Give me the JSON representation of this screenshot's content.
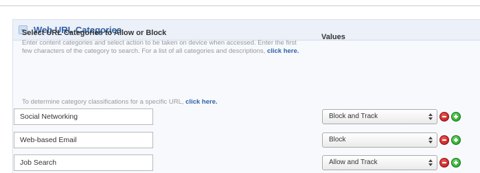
{
  "panel": {
    "title": "Web URL Categories"
  },
  "section": {
    "title": "Select URL Categories to Allow or Block",
    "values_header": "Values",
    "description": "Enter content categories and select action to be taken on device when accessed. Enter the first few characters of the category to search. For a list of all categories and descriptions,",
    "description_link": "click here.",
    "determine_text": "To determine category classifications for a specific URL,",
    "determine_link": "click here."
  },
  "rows": [
    {
      "category": "Social Networking",
      "action": "Block and Track"
    },
    {
      "category": "Web-based Email",
      "action": "Block"
    },
    {
      "category": "Job Search",
      "action": "Allow and Track"
    }
  ],
  "icons": {
    "collapse": "collapse-minus-icon",
    "remove": "remove-red-minus-icon",
    "add": "add-green-plus-icon"
  },
  "colors": {
    "accent": "#2d62a8",
    "remove": "#d21f1f",
    "add": "#2fa82f"
  }
}
